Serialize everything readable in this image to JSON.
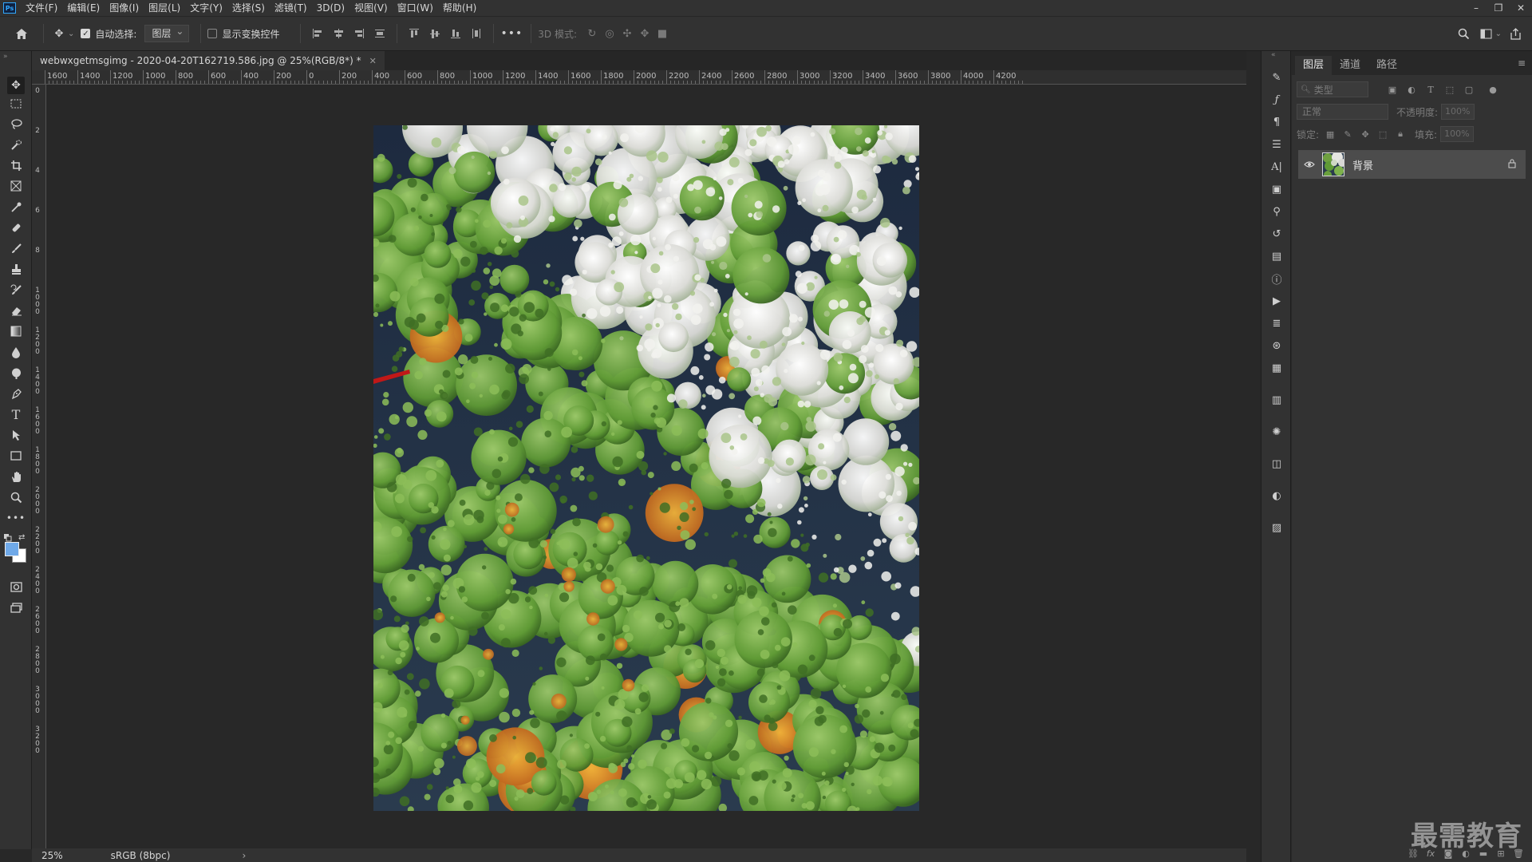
{
  "menubar": {
    "logo": "Ps",
    "items": [
      "文件(F)",
      "编辑(E)",
      "图像(I)",
      "图层(L)",
      "文字(Y)",
      "选择(S)",
      "滤镜(T)",
      "3D(D)",
      "视图(V)",
      "窗口(W)",
      "帮助(H)"
    ],
    "window_controls": [
      "minimize-icon",
      "restore-icon",
      "close-icon"
    ]
  },
  "optionsbar": {
    "auto_select_label": "自动选择:",
    "auto_select_checked": true,
    "auto_select_target": "图层",
    "show_transform_label": "显示变换控件",
    "show_transform_checked": false,
    "more": "•••",
    "mode_3d_label": "3D 模式:"
  },
  "document": {
    "tab_title": "webwxgetmsgimg - 2020-04-20T162719.586.jpg @ 25%(RGB/8*) *",
    "zoom": "25%",
    "color_profile": "sRGB (8bpc)"
  },
  "ruler": {
    "top_labels": [
      "1600",
      "1400",
      "1200",
      "1000",
      "800",
      "600",
      "400",
      "200",
      "0",
      "200",
      "400",
      "600",
      "800",
      "1000",
      "1200",
      "1400",
      "1600",
      "1800",
      "2000",
      "2200",
      "2400",
      "2600",
      "2800",
      "3000",
      "3200",
      "3400",
      "3600",
      "3800",
      "4000",
      "4200"
    ],
    "left_labels": [
      "0",
      "2",
      "4",
      "6",
      "8",
      "1000",
      "1200",
      "1400",
      "1600",
      "1800",
      "2000",
      "2200",
      "2400",
      "2600",
      "2800",
      "3000",
      "3200"
    ]
  },
  "tools": [
    "move-icon",
    "marquee-icon",
    "lasso-icon",
    "quick-select-icon",
    "crop-icon",
    "frame-icon",
    "eyedropper-icon",
    "healing-icon",
    "brush-icon",
    "stamp-icon",
    "history-brush-icon",
    "eraser-icon",
    "gradient-icon",
    "blur-icon",
    "dodge-icon",
    "pen-icon",
    "type-icon",
    "path-select-icon",
    "rectangle-icon",
    "hand-icon",
    "zoom-icon",
    "more-tools-icon"
  ],
  "colors": {
    "foreground": "#6fa9e8",
    "background": "#ffffff",
    "accent": "#31a8ff"
  },
  "layers_panel": {
    "tabs": [
      "图层",
      "通道",
      "路径"
    ],
    "active_tab": "图层",
    "search_placeholder": "类型",
    "blend_mode": "正常",
    "opacity_label": "不透明度:",
    "opacity_value": "100%",
    "lock_label": "锁定:",
    "fill_label": "填充:",
    "fill_value": "100%",
    "layers": [
      {
        "name": "背景",
        "visible": true,
        "locked": true
      }
    ],
    "bottom_icons": [
      "link-icon",
      "fx-icon",
      "mask-icon",
      "adjustment-icon",
      "group-icon",
      "new-layer-icon",
      "trash-icon"
    ]
  },
  "watermark": "最需教育"
}
